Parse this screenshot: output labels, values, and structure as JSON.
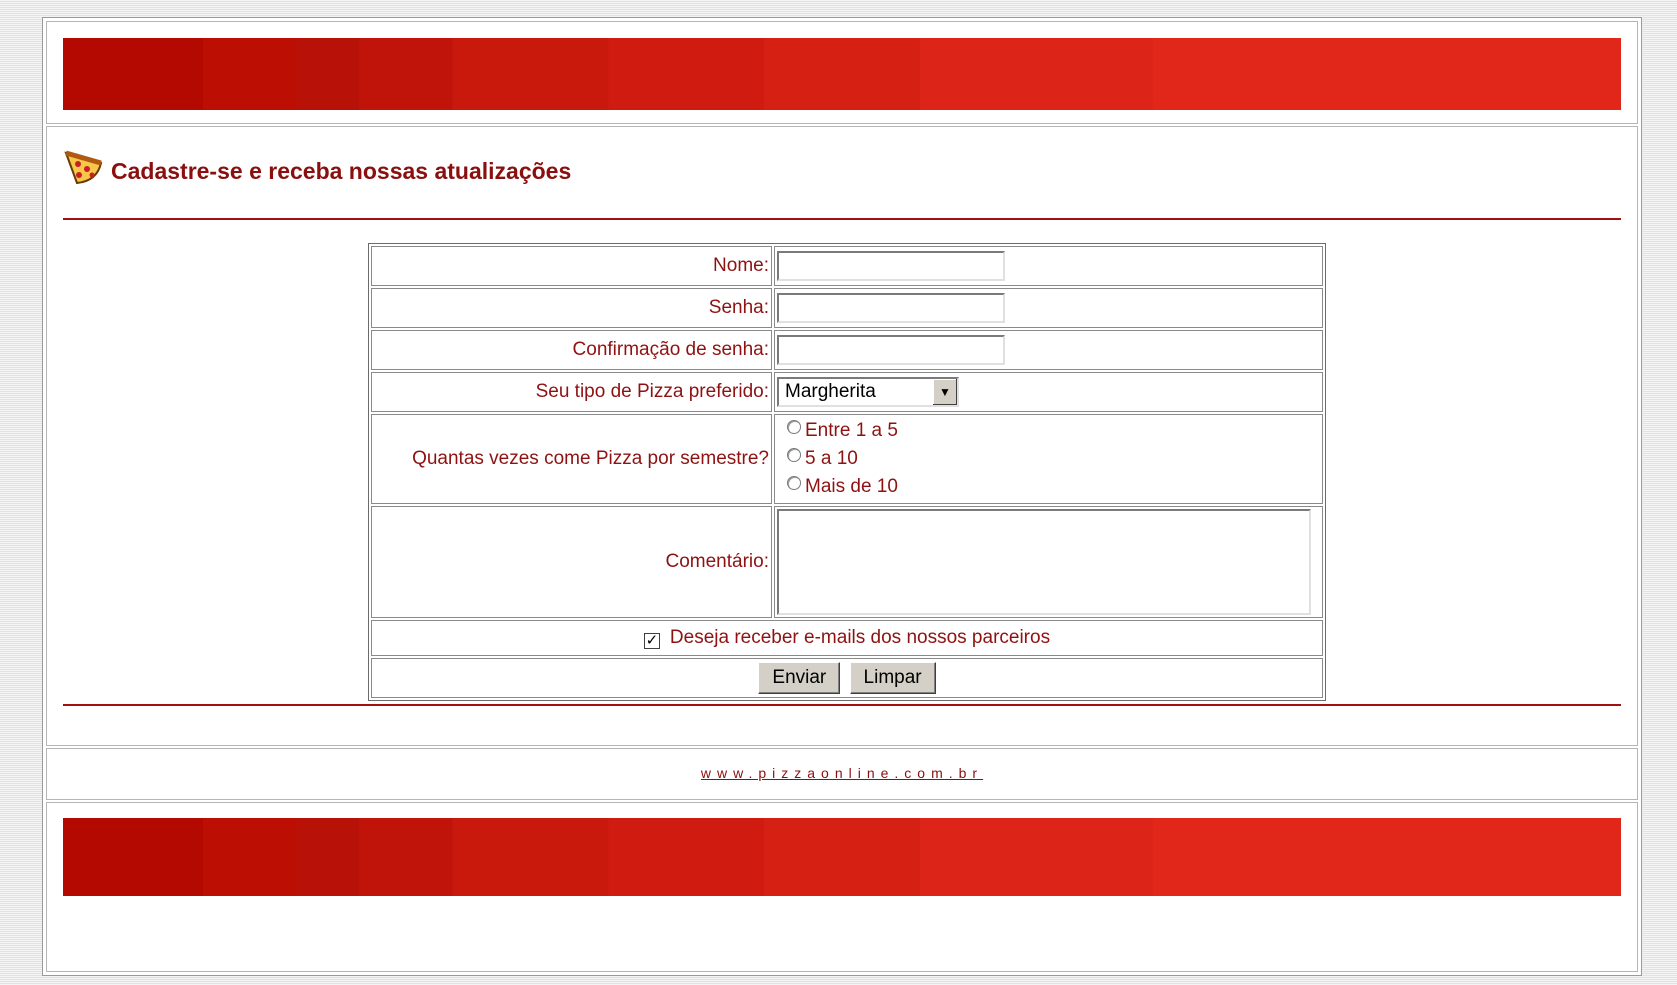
{
  "page": {
    "heading": "Cadastre-se e receba nossas atualizações",
    "heading_icon": "pizza-slice-icon"
  },
  "form": {
    "fields": {
      "nome_label": "Nome:",
      "nome_value": "",
      "senha_label": "Senha:",
      "senha_value": "",
      "confirmacao_label": "Confirmação de senha:",
      "confirmacao_value": "",
      "pizza_label": "Seu tipo de Pizza preferido:",
      "pizza_selected": "Margherita",
      "frequencia_label": "Quantas vezes come Pizza por semestre?",
      "comentario_label": "Comentário:",
      "comentario_value": ""
    },
    "frequencia_options": [
      {
        "label": "Entre 1 a 5",
        "checked": false
      },
      {
        "label": "5 a 10",
        "checked": false
      },
      {
        "label": "Mais de 10",
        "checked": false
      }
    ],
    "newsletter": {
      "label": "Deseja receber e-mails dos nossos parceiros",
      "checked": true
    },
    "buttons": {
      "submit": "Enviar",
      "reset": "Limpar"
    }
  },
  "footer": {
    "link": "www.pizzaonline.com.br"
  },
  "colors": {
    "banner_dark": "#b30900",
    "banner_light": "#e0271a",
    "text_accent": "#8a0f0f",
    "rule": "#a01010"
  }
}
